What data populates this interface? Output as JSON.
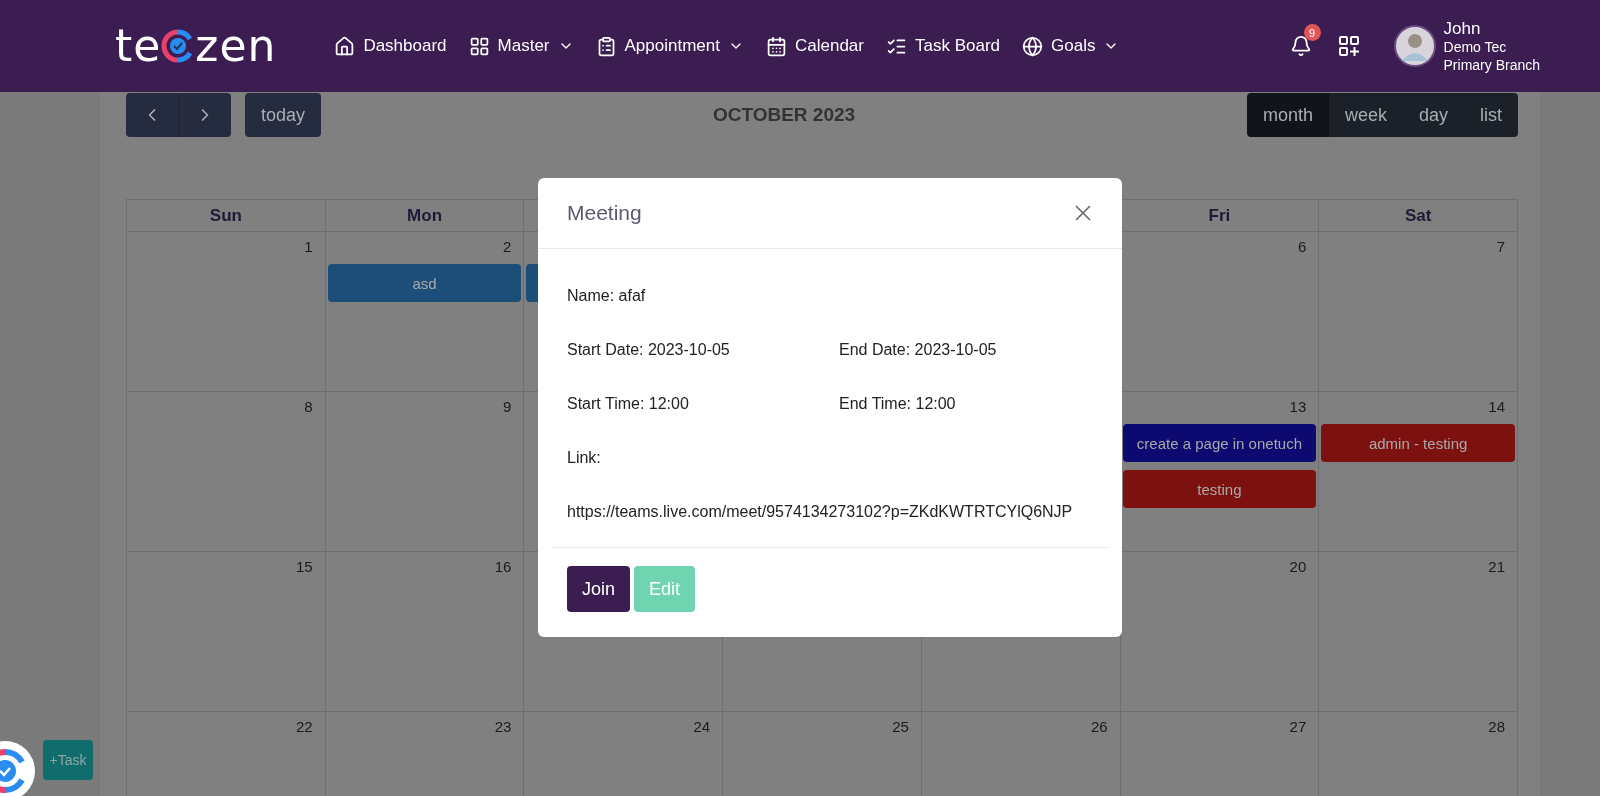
{
  "header": {
    "logo": [
      "te",
      "zen"
    ],
    "nav": [
      {
        "label": "Dashboard",
        "dropdown": false
      },
      {
        "label": "Master",
        "dropdown": true
      },
      {
        "label": "Appointment",
        "dropdown": true
      },
      {
        "label": "Calendar",
        "dropdown": false
      },
      {
        "label": "Task Board",
        "dropdown": false
      },
      {
        "label": "Goals",
        "dropdown": true
      }
    ],
    "notifications": "9",
    "user": {
      "name": "John",
      "company": "Demo Tec",
      "branch": "Primary Branch"
    }
  },
  "toolbar": {
    "today": "today",
    "title": "OCTOBER 2023",
    "views": [
      {
        "label": "month",
        "selected": true
      },
      {
        "label": "week",
        "selected": false
      },
      {
        "label": "day",
        "selected": false
      },
      {
        "label": "list",
        "selected": false
      }
    ]
  },
  "calendar": {
    "weekdays": {
      "start": [
        "Sun",
        "Mon"
      ],
      "end": [
        "Fri",
        "Sat"
      ]
    },
    "weeks": [
      {
        "start": [
          {
            "number": "1"
          },
          {
            "number": "2",
            "events": [
              {
                "title": "asd",
                "color": "#1d4e7a"
              }
            ]
          },
          {
            "events": [
              {
                "color": "#1d4e7a"
              }
            ]
          }
        ],
        "end": [
          {
            "number": "6"
          },
          {
            "number": "7"
          }
        ]
      },
      {
        "start": [
          {
            "number": "8"
          },
          {
            "number": "9"
          }
        ],
        "end": [
          {
            "number": "13",
            "events": [
              {
                "title": "create a page in onetuch",
                "color": "#0c0a70"
              },
              {
                "title": "testing",
                "color": "#7d1110"
              }
            ]
          },
          {
            "number": "14",
            "events": [
              {
                "title": "admin - testing",
                "color": "#7d1110"
              }
            ]
          }
        ]
      },
      {
        "start": [
          {
            "number": "15"
          },
          {
            "number": "16"
          }
        ],
        "end": [
          {
            "number": "20"
          },
          {
            "number": "21"
          }
        ]
      },
      {
        "start": [
          {
            "number": "22"
          },
          {
            "number": "23"
          },
          {
            "number": "24"
          },
          {
            "number": "25"
          },
          {
            "number": "26"
          },
          {
            "number": "27"
          },
          {
            "number": "28"
          }
        ]
      }
    ]
  },
  "modal": {
    "title": "Meeting",
    "rows": [
      {
        "cells": [
          "Name: afaf"
        ]
      },
      {
        "cells": [
          "Start Date: 2023-10-05",
          "End Date: 2023-10-05"
        ]
      },
      {
        "cells": [
          "Start Time: 12:00",
          "End Time: 12:00"
        ]
      },
      {
        "cells": [
          "Link:"
        ]
      },
      {
        "cells": [
          "https://teams.live.com/meet/9574134273102?p=ZKdKWTRTCYlQ6NJP"
        ]
      }
    ],
    "buttons": [
      {
        "label": "Join",
        "kind": "primary",
        "disabled": false
      },
      {
        "label": "Edit",
        "kind": "success",
        "disabled": true
      }
    ]
  },
  "task_button": "+Task"
}
